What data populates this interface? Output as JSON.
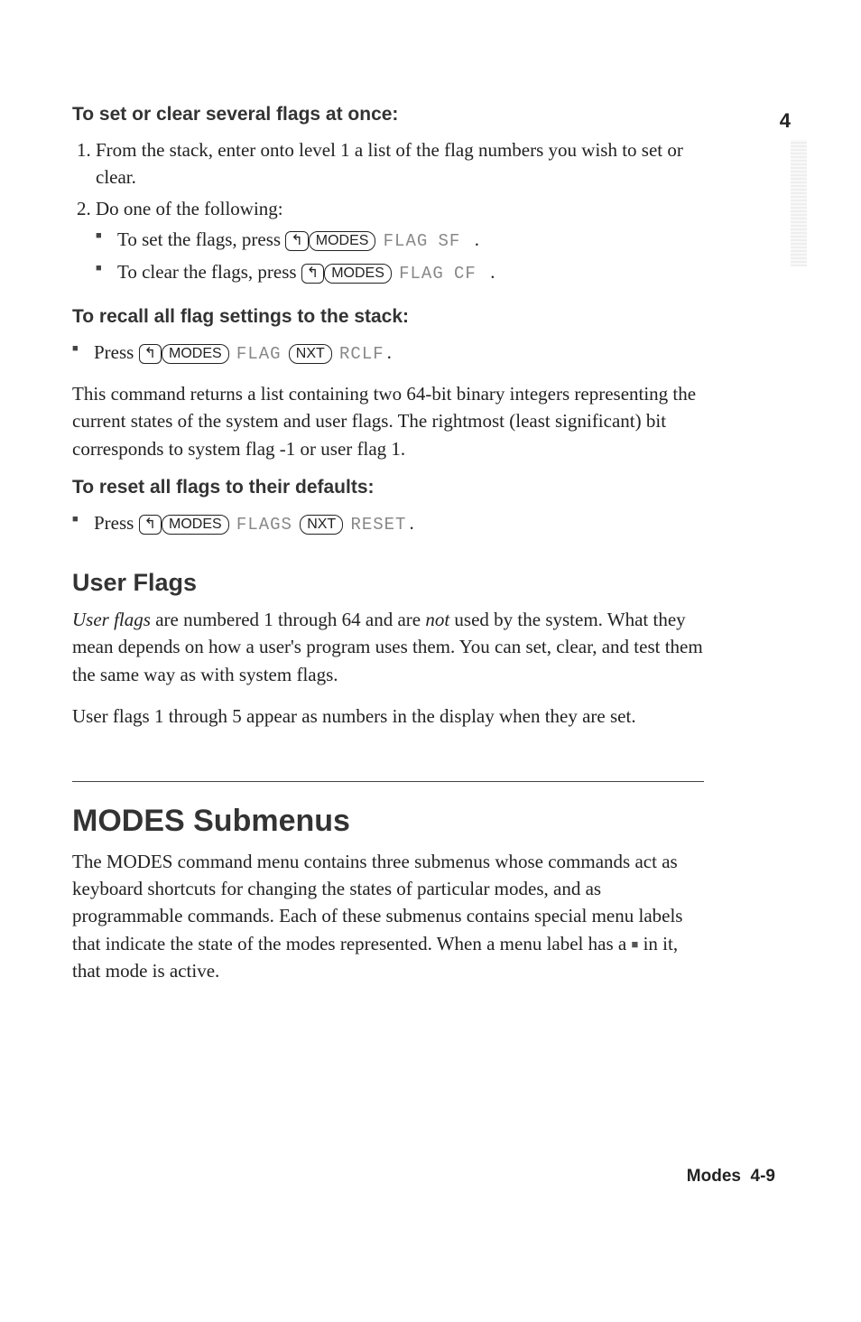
{
  "side_page_number": "4",
  "sections": {
    "proc1": {
      "title": "To set or clear several flags at once:",
      "step1": "From the stack, enter onto level 1 a list of the flag numbers you wish to set or clear.",
      "step2": "Do one of the following:",
      "sub_a_pre": "To set the flags, press ",
      "sub_b_pre": "To clear the flags, press ",
      "key_shift": "↰",
      "key_modes": "MODES",
      "menu_flag": "FLAG",
      "menu_sf": "  SF  ",
      "menu_cf": "  CF  ",
      "period": "."
    },
    "proc2": {
      "title": "To recall all flag settings to the stack:",
      "line_pre": "Press ",
      "key_shift": "↰",
      "key_modes": "MODES",
      "menu_flag": "FLAG",
      "key_nxt": "NXT",
      "menu_rclf": "RCLF",
      "period": ".",
      "para": "This command returns a list containing two 64-bit binary integers representing the current states of the system and user flags. The rightmost (least significant) bit corresponds to system flag -1 or user flag 1."
    },
    "proc3": {
      "title": "To reset all flags to their defaults:",
      "line_pre": "Press ",
      "key_shift": "↰",
      "key_modes": "MODES",
      "menu_flags": "FLAGS",
      "key_nxt": "NXT",
      "menu_reset": "RESET",
      "period": "."
    },
    "userflags": {
      "title": "User Flags",
      "para1_a": "User flags",
      "para1_b": " are numbered 1 through 64 and are ",
      "para1_c": "not",
      "para1_d": " used by the system. What they mean depends on how a user's program uses them. You can set, clear, and test them the same way as with system flags.",
      "para2": "User flags 1 through 5 appear as numbers in the display when they are set."
    },
    "modes": {
      "title": "MODES Submenus",
      "para_a": "The MODES command menu contains three submenus whose commands act as keyboard shortcuts for changing the states of particular modes, and as programmable commands. Each of these submenus contains special menu labels that indicate the state of the modes represented. When a menu label has a ",
      "glyph": "■",
      "para_b": " in it, that mode is active."
    }
  },
  "footer": {
    "label": "Modes",
    "page": "4-9"
  }
}
